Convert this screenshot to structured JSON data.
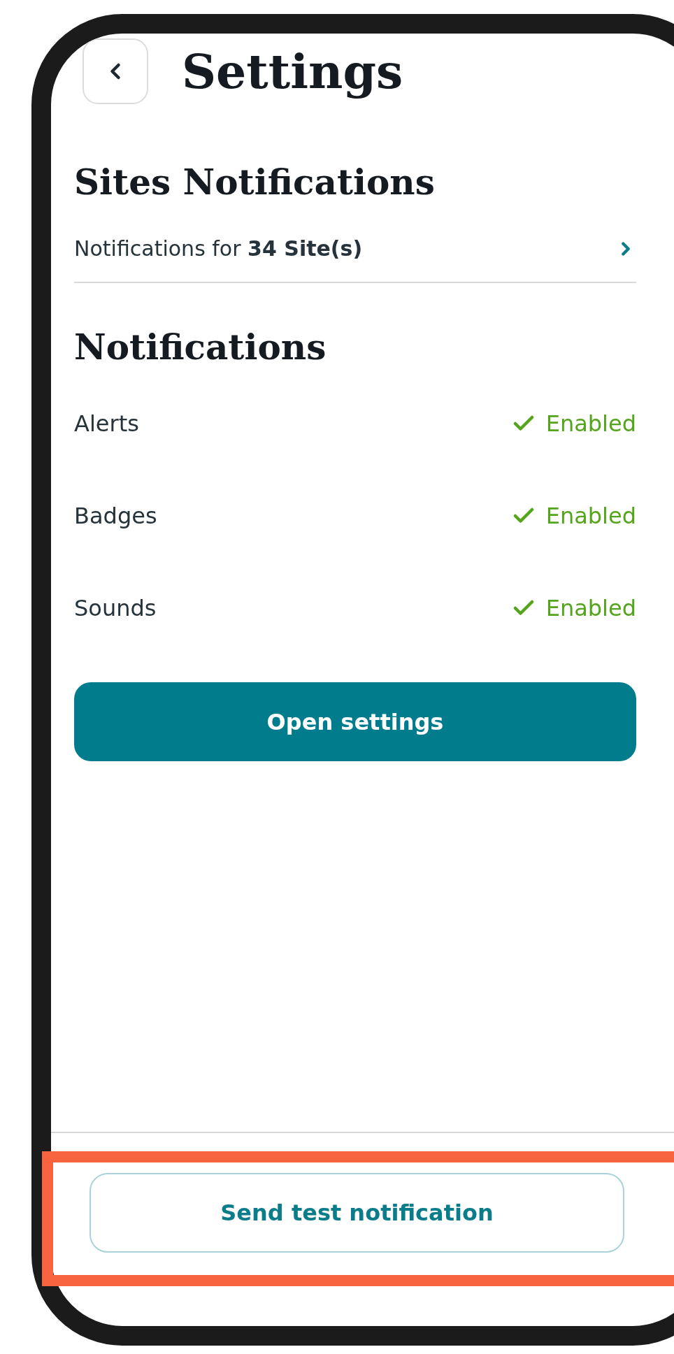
{
  "header": {
    "title": "Settings"
  },
  "sites_section": {
    "title": "Sites Notifications",
    "link": "Notifications for **34 Site(s)**"
  },
  "notifications_section": {
    "title": "Notifications",
    "rows": [
      {
        "label": "Alerts",
        "status": "Enabled",
        "enabled": true
      },
      {
        "label": "Badges",
        "status": "Enabled",
        "enabled": true
      },
      {
        "label": "Sounds",
        "status": "Enabled",
        "enabled": true
      }
    ],
    "button": "Open settings"
  },
  "footer": {
    "button": "Send test notification"
  }
}
